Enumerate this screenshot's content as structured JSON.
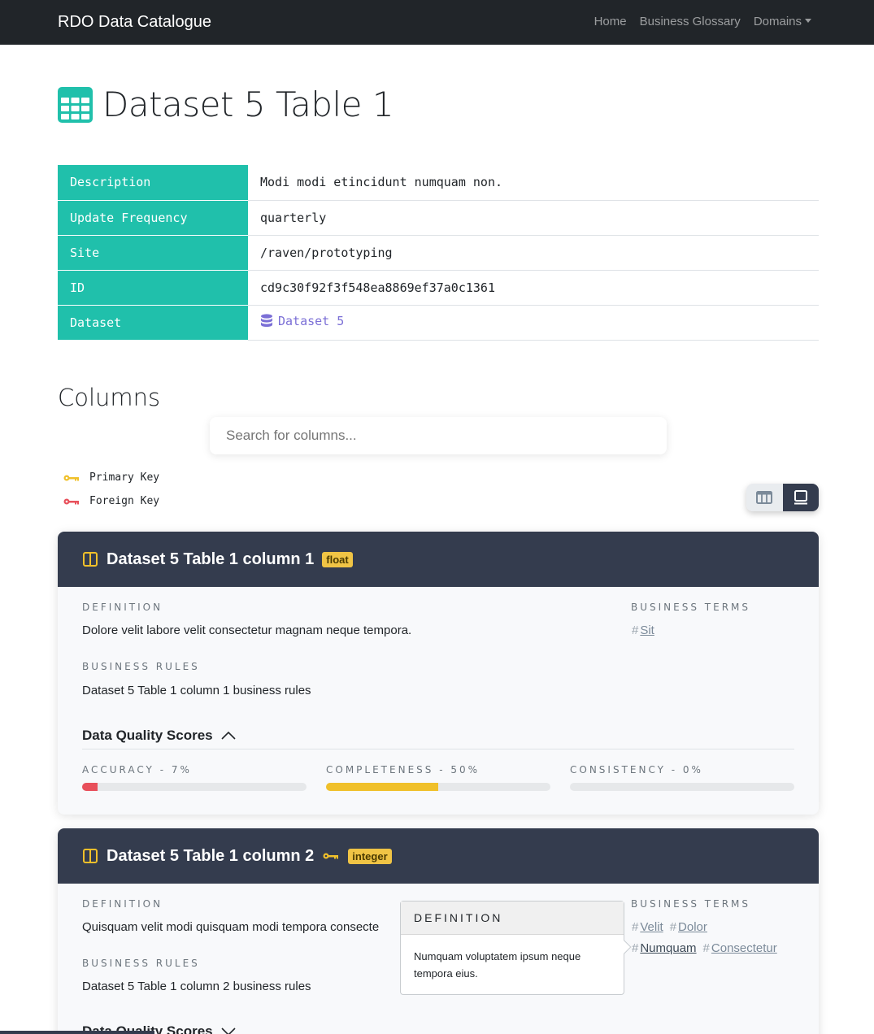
{
  "nav": {
    "brand": "RDO Data Catalogue",
    "links": [
      "Home",
      "Business Glossary",
      "Domains"
    ]
  },
  "page": {
    "title": "Dataset 5 Table 1"
  },
  "meta": {
    "rows": [
      {
        "key": "Description",
        "value": "Modi modi etincidunt numquam non."
      },
      {
        "key": "Update Frequency",
        "value": "quarterly"
      },
      {
        "key": "Site",
        "value": "/raven/prototyping"
      },
      {
        "key": "ID",
        "value": "cd9c30f92f3f548ea8869ef37a0c1361"
      },
      {
        "key": "Dataset",
        "value": "Dataset 5"
      }
    ]
  },
  "columns_section": {
    "title": "Columns",
    "search_placeholder": "Search for columns...",
    "legend": {
      "primary": "Primary Key",
      "foreign": "Foreign Key"
    }
  },
  "labels": {
    "definition": "DEFINITION",
    "business_terms": "BUSINESS TERMS",
    "business_rules": "BUSINESS RULES",
    "dq_title": "Data Quality Scores"
  },
  "cards": [
    {
      "title": "Dataset 5 Table 1 column 1",
      "type": "float",
      "definition": "Dolore velit labore velit consectetur magnam neque tempora.",
      "business_rules": "Dataset 5 Table 1 column 1 business rules",
      "terms": [
        "Sit"
      ],
      "scores": [
        {
          "label": "ACCURACY - 7%",
          "value": 7,
          "color": "#e8505b"
        },
        {
          "label": "COMPLETENESS - 50%",
          "value": 50,
          "color": "#f0c02a"
        },
        {
          "label": "CONSISTENCY - 0%",
          "value": 0,
          "color": "#20c0ab"
        }
      ]
    },
    {
      "title": "Dataset 5 Table 1 column 2",
      "type": "integer",
      "definition": "Quisquam velit modi quisquam modi tempora consecte",
      "business_rules": "Dataset 5 Table 1 column 2 business rules",
      "terms_row1": [
        "Velit",
        "Dolor"
      ],
      "terms_row2": [
        "Numquam",
        "Consectetur"
      ]
    }
  ],
  "popover": {
    "title": "DEFINITION",
    "body": "Numquam voluptatem ipsum neque tempora eius."
  },
  "colors": {
    "navbar": "#212529",
    "teal": "#20c0ab",
    "card_head": "#343c4e",
    "badge": "#f0c445"
  }
}
